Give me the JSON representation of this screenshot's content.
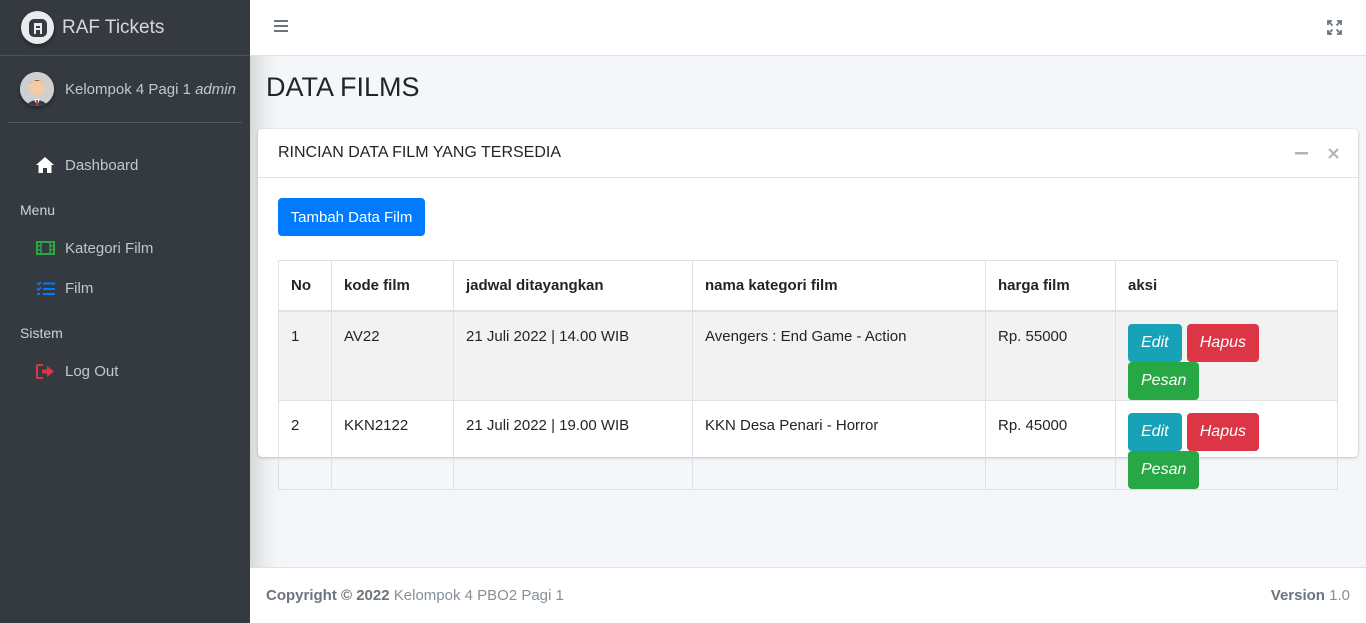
{
  "brand": {
    "name": "RAF Tickets"
  },
  "user": {
    "name": "Kelompok 4 Pagi 1",
    "role": "admin"
  },
  "sidebar": {
    "dashboard": "Dashboard",
    "menu_header": "Menu",
    "kategori": "Kategori Film",
    "film": "Film",
    "sistem_header": "Sistem",
    "logout": "Log Out",
    "colors": {
      "kategori_icon": "#28a745",
      "film_icon": "#007bff",
      "logout_icon": "#dc3545"
    }
  },
  "page": {
    "title": "DATA FILMS"
  },
  "card": {
    "title": "RINCIAN DATA FILM YANG TERSEDIA",
    "add_button": "Tambah Data Film"
  },
  "table": {
    "headers": [
      "No",
      "kode film",
      "jadwal ditayangkan",
      "nama kategori film",
      "harga film",
      "aksi"
    ],
    "rows": [
      {
        "no": "1",
        "kode": "AV22",
        "jadwal": "21 Juli 2022 | 14.00 WIB",
        "kategori": "Avengers : End Game - Action",
        "harga": "Rp. 55000"
      },
      {
        "no": "2",
        "kode": "KKN2122",
        "jadwal": "21 Juli 2022 | 19.00 WIB",
        "kategori": "KKN Desa Penari - Horror",
        "harga": "Rp. 45000"
      }
    ],
    "actions": {
      "edit": "Edit",
      "hapus": "Hapus",
      "pesan": "Pesan"
    }
  },
  "footer": {
    "copyright": "Copyright © 2022",
    "team": "Kelompok 4 PBO2 Pagi 1",
    "version_label": "Version",
    "version": "1.0"
  }
}
